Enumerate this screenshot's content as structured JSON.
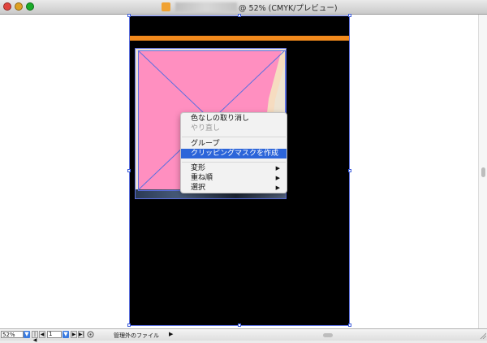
{
  "window": {
    "title": "@ 52% (CMYK/プレビュー)"
  },
  "context_menu": {
    "items": [
      {
        "label": "色なしの取り消し",
        "enabled": true
      },
      {
        "label": "やり直し",
        "enabled": false
      },
      {
        "label": "グループ",
        "enabled": true
      },
      {
        "label": "クリッピングマスクを作成",
        "enabled": true,
        "highlighted": true
      },
      {
        "label": "変形",
        "enabled": true,
        "submenu": true
      },
      {
        "label": "重ね順",
        "enabled": true,
        "submenu": true
      },
      {
        "label": "選択",
        "enabled": true,
        "submenu": true
      }
    ],
    "submenu_arrow": "▶"
  },
  "statusbar": {
    "zoom": "52%",
    "page": "1",
    "status_text": "管理外のファイル",
    "arrow": "▶",
    "dropdown_glyph": "▼",
    "first_page_glyph": "|◀",
    "prev_page_glyph": "◀",
    "next_page_glyph": "▶",
    "last_page_glyph": "▶|"
  },
  "colors": {
    "artboard": "#000000",
    "accent_bar": "#f28a1c",
    "shape_fill": "#ff8fc0",
    "selection": "#5b6fe0",
    "menu_highlight": "#2c65d9"
  }
}
